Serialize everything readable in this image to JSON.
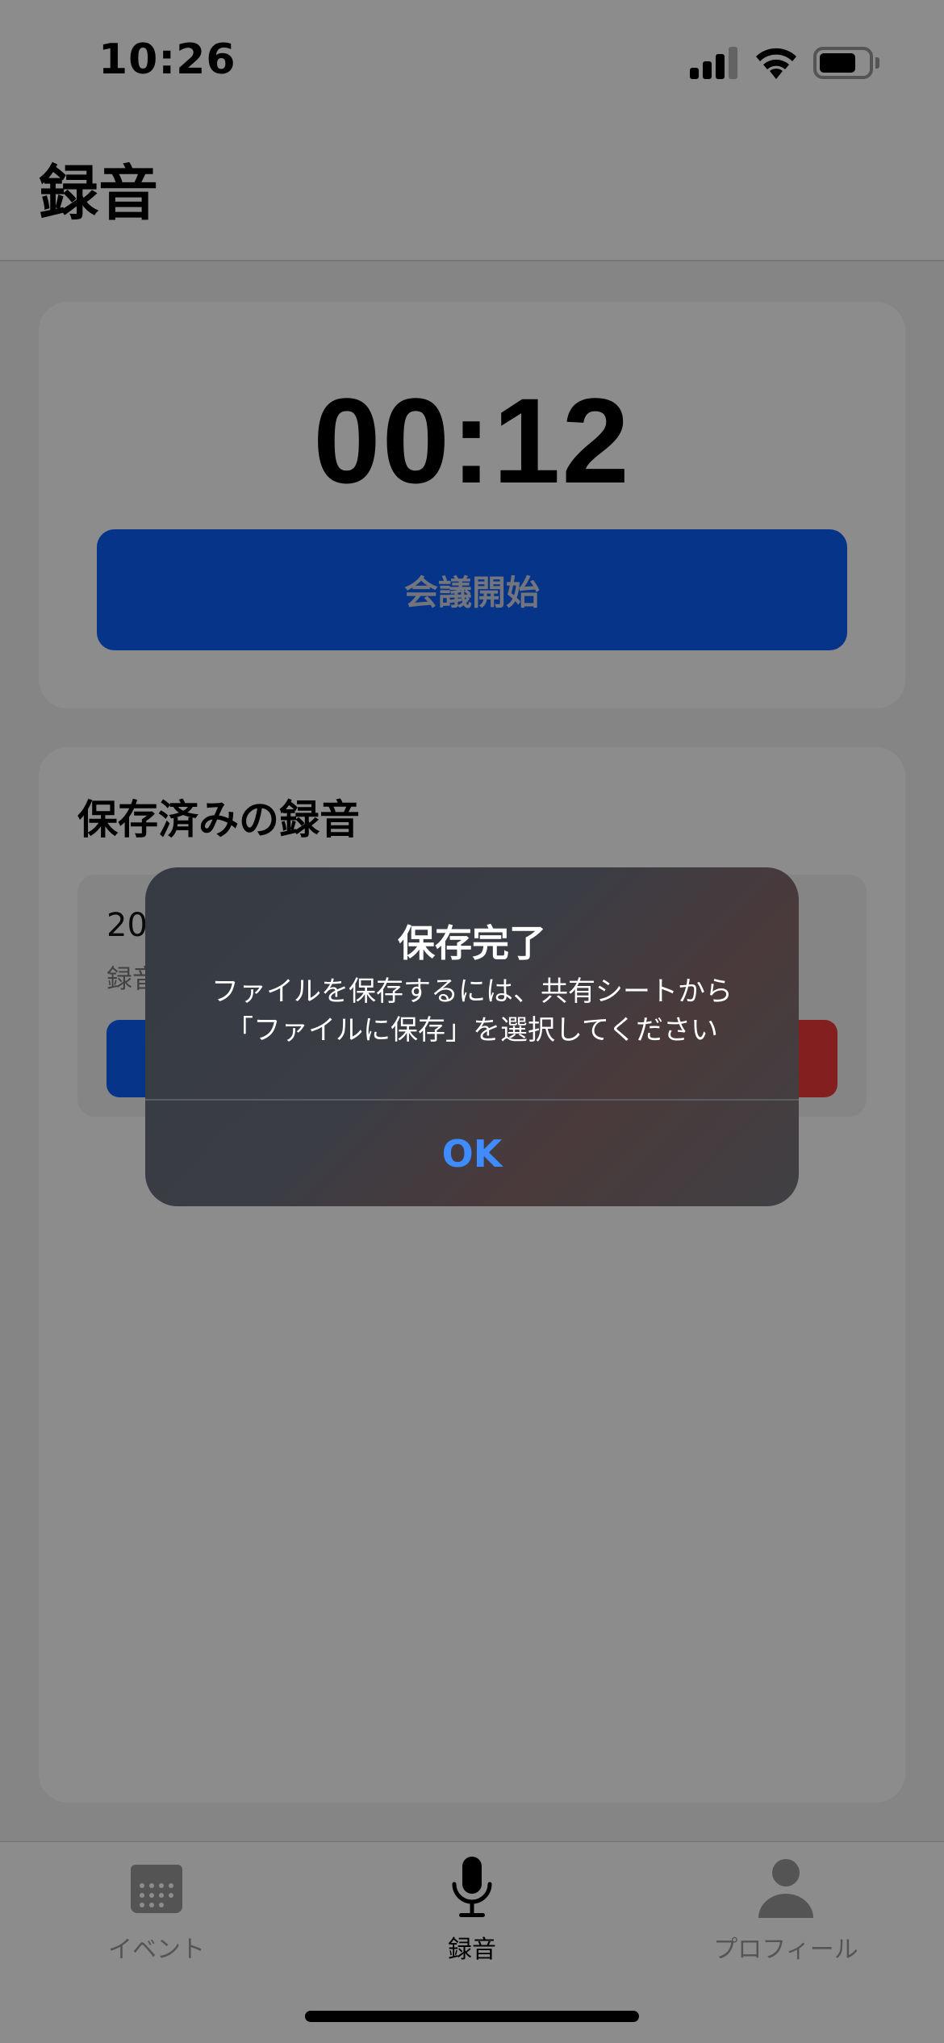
{
  "status_bar": {
    "time": "10:26"
  },
  "header": {
    "title": "録音"
  },
  "timer_card": {
    "elapsed": "00:12",
    "start_button_label": "会議開始"
  },
  "saved_section": {
    "title": "保存済みの録音",
    "items": [
      {
        "name_partial": "20",
        "subtitle_partial": "録音"
      }
    ]
  },
  "tabs": [
    {
      "label": "イベント",
      "icon": "calendar-icon",
      "active": false
    },
    {
      "label": "録音",
      "icon": "microphone-icon",
      "active": true
    },
    {
      "label": "プロフィール",
      "icon": "person-icon",
      "active": false
    }
  ],
  "alert": {
    "title": "保存完了",
    "message": "ファイルを保存するには、共有シートから\n「ファイルに保存」を選択してください",
    "ok_label": "OK"
  },
  "colors": {
    "accent": "#0a5ffa",
    "destructive": "#f03a3a",
    "alert_button": "#3f8bff"
  }
}
